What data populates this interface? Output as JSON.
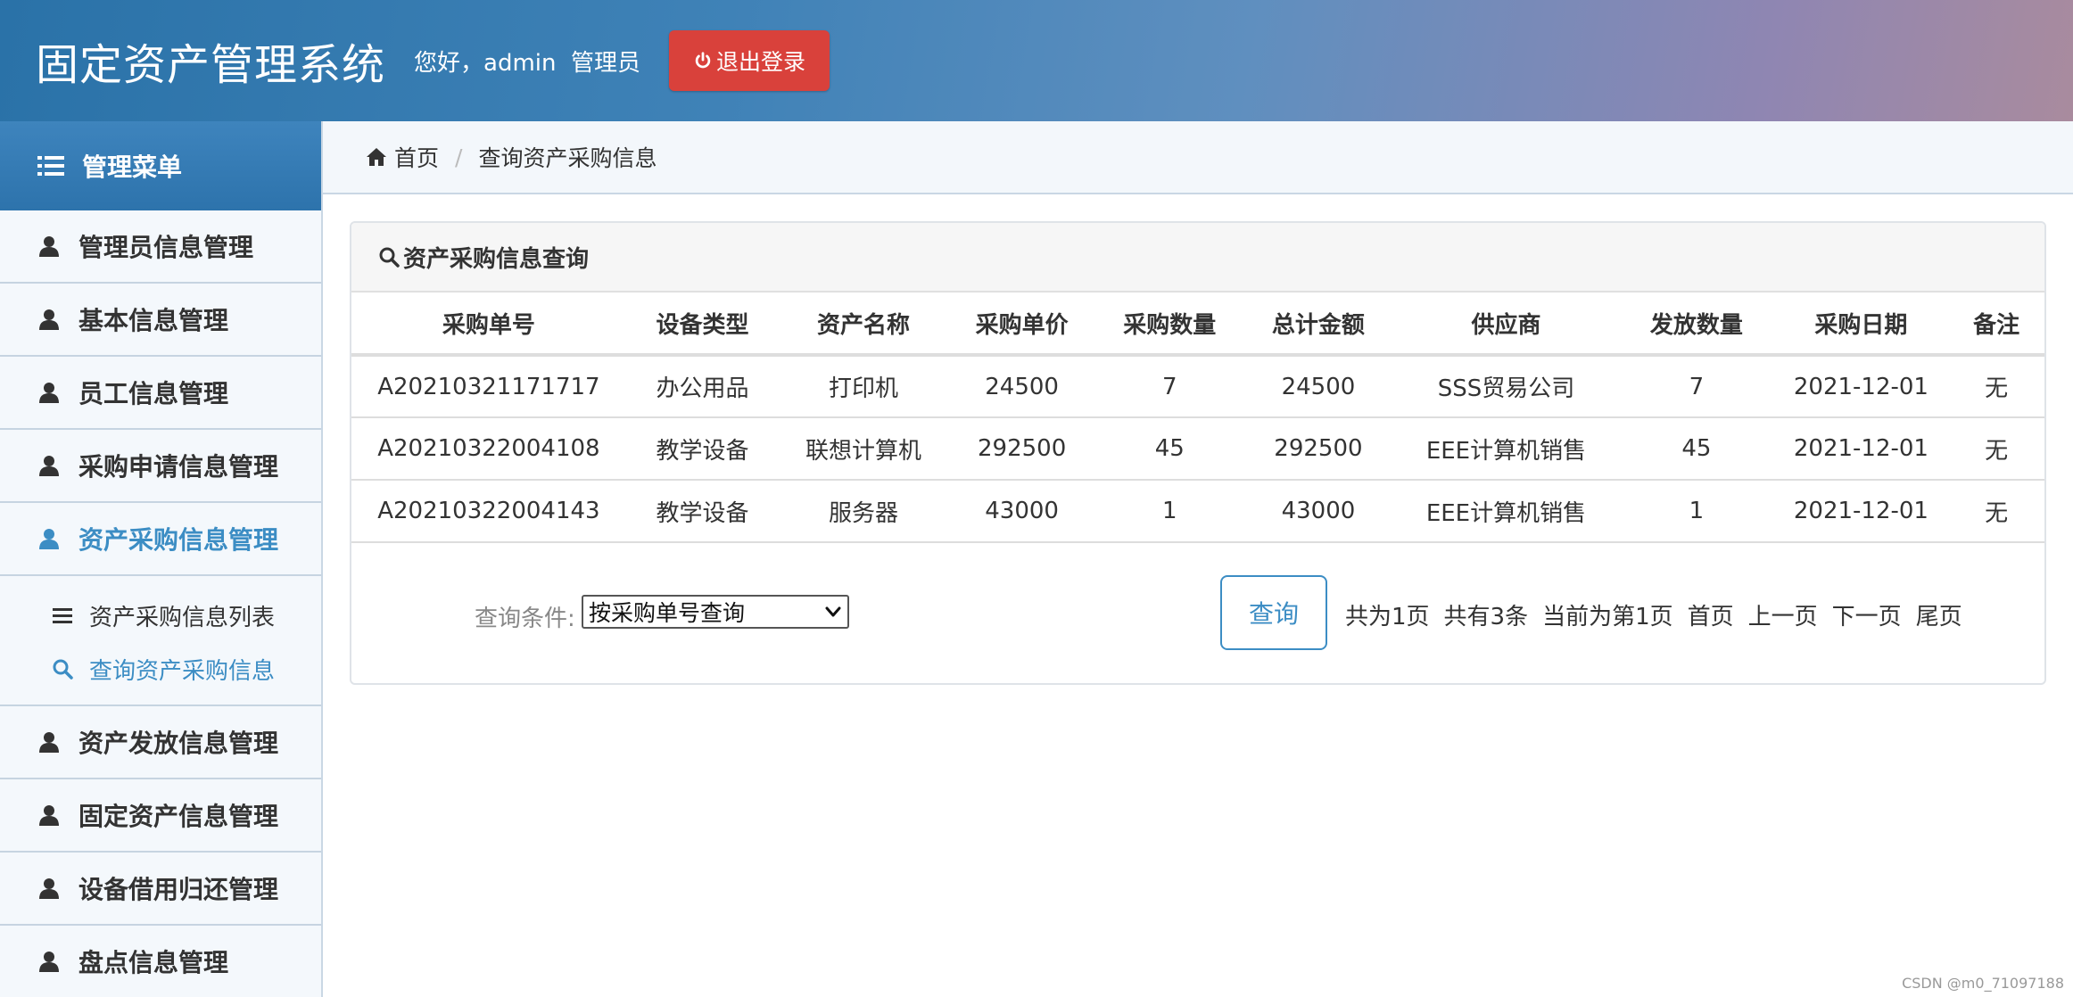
{
  "header": {
    "app_title": "固定资产管理系统",
    "greeting": "您好，admin  管理员",
    "logout_label": "退出登录"
  },
  "sidebar": {
    "title": "管理菜单",
    "items": [
      {
        "label": "管理员信息管理"
      },
      {
        "label": "基本信息管理"
      },
      {
        "label": "员工信息管理"
      },
      {
        "label": "采购申请信息管理"
      },
      {
        "label": "资产采购信息管理"
      },
      {
        "label": "资产发放信息管理"
      },
      {
        "label": "固定资产信息管理"
      },
      {
        "label": "设备借用归还管理"
      },
      {
        "label": "盘点信息管理"
      }
    ],
    "submenu": [
      {
        "label": "资产采购信息列表"
      },
      {
        "label": "查询资产采购信息"
      }
    ]
  },
  "breadcrumb": {
    "home": "首页",
    "current": "查询资产采购信息"
  },
  "panel": {
    "title": "资产采购信息查询"
  },
  "table": {
    "headers": [
      "采购单号",
      "设备类型",
      "资产名称",
      "采购单价",
      "采购数量",
      "总计金额",
      "供应商",
      "发放数量",
      "采购日期",
      "备注"
    ],
    "rows": [
      [
        "A20210321171717",
        "办公用品",
        "打印机",
        "24500",
        "7",
        "24500",
        "SSS贸易公司",
        "7",
        "2021-12-01",
        "无"
      ],
      [
        "A20210322004108",
        "教学设备",
        "联想计算机",
        "292500",
        "45",
        "292500",
        "EEE计算机销售",
        "45",
        "2021-12-01",
        "无"
      ],
      [
        "A20210322004143",
        "教学设备",
        "服务器",
        "43000",
        "1",
        "43000",
        "EEE计算机销售",
        "1",
        "2021-12-01",
        "无"
      ]
    ]
  },
  "query": {
    "condition_label": "查询条件:",
    "condition_value": "按采购单号查询",
    "button_label": "查询"
  },
  "pager": {
    "total_pages": "共为1页",
    "total_records": "共有3条",
    "current_page": "当前为第1页",
    "first": "首页",
    "prev": "上一页",
    "next": "下一页",
    "last": "尾页"
  },
  "watermark": "CSDN @m0_71097188",
  "colors": {
    "accent": "#3c8dc4",
    "logout": "#d9413b",
    "header_start": "#2a72a8"
  }
}
